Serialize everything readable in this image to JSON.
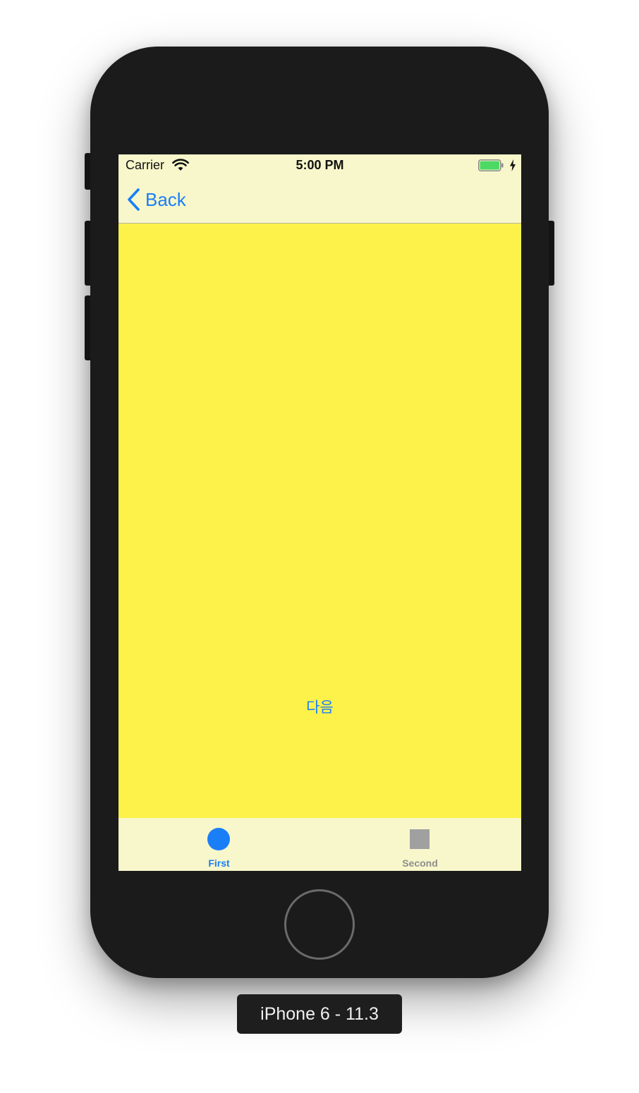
{
  "status_bar": {
    "carrier": "Carrier",
    "time": "5:00 PM",
    "wifi_icon": "wifi-icon",
    "battery_icon": "battery-icon",
    "charging_icon": "charging-bolt-icon"
  },
  "nav_bar": {
    "back_label": "Back",
    "back_icon": "chevron-left-icon"
  },
  "content": {
    "next_button_label": "다음"
  },
  "tab_bar": {
    "tabs": [
      {
        "label": "First",
        "icon": "circle-icon",
        "selected": true
      },
      {
        "label": "Second",
        "icon": "square-icon",
        "selected": false
      }
    ]
  },
  "device": {
    "label": "iPhone 6 - 11.3"
  },
  "colors": {
    "content_background": "#fcf24a",
    "bar_background": "#f7f7cb",
    "tint": "#1a7ef7",
    "inactive_tab": "#8e8e8e",
    "device_body": "#1b1b1b"
  }
}
